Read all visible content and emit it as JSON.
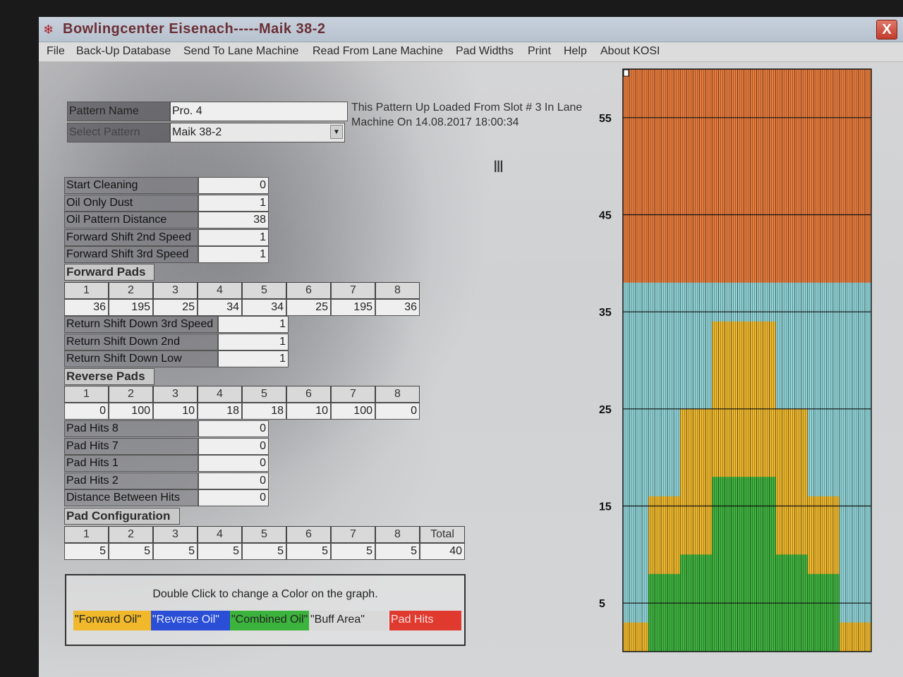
{
  "window": {
    "title": "Bowlingcenter Eisenach-----Maik 38-2",
    "close_label": "X"
  },
  "menu": [
    "File",
    "Back-Up Database",
    "Send To Lane Machine",
    "Read From Lane Machine",
    "Pad Widths",
    "Print",
    "Help",
    "About KOSI"
  ],
  "pattern": {
    "name_label": "Pattern Name",
    "name_value": "Pro. 4",
    "select_label": "Select Pattern",
    "select_value": "Maik 38-2",
    "info": "This Pattern Up Loaded From Slot # 3 In Lane Machine On 14.08.2017 18:00:34"
  },
  "settings": [
    {
      "label": "Start Cleaning",
      "value": "0"
    },
    {
      "label": "Oil Only Dust",
      "value": "1"
    },
    {
      "label": "Oil Pattern Distance",
      "value": "38"
    },
    {
      "label": "Forward Shift 2nd Speed",
      "value": "1"
    },
    {
      "label": "Forward Shift 3rd Speed",
      "value": "1"
    }
  ],
  "forward_pads": {
    "title": "Forward Pads",
    "headers": [
      "1",
      "2",
      "3",
      "4",
      "5",
      "6",
      "7",
      "8"
    ],
    "values": [
      "36",
      "195",
      "25",
      "34",
      "34",
      "25",
      "195",
      "36"
    ]
  },
  "return_shift": [
    {
      "label": "Return Shift Down 3rd Speed",
      "value": "1"
    },
    {
      "label": "Return Shift Down 2nd",
      "value": "1"
    },
    {
      "label": "Return Shift Down Low",
      "value": "1"
    }
  ],
  "reverse_pads": {
    "title": "Reverse Pads",
    "headers": [
      "1",
      "2",
      "3",
      "4",
      "5",
      "6",
      "7",
      "8"
    ],
    "values": [
      "0",
      "100",
      "10",
      "18",
      "18",
      "10",
      "100",
      "0"
    ]
  },
  "pad_hits": [
    {
      "label": "Pad Hits 8",
      "value": "0"
    },
    {
      "label": "Pad Hits 7",
      "value": "0"
    },
    {
      "label": "Pad Hits 1",
      "value": "0"
    },
    {
      "label": "Pad Hits 2",
      "value": "0"
    },
    {
      "label": "Distance Between Hits",
      "value": "0"
    }
  ],
  "pad_config": {
    "title": "Pad Configuration",
    "headers": [
      "1",
      "2",
      "3",
      "4",
      "5",
      "6",
      "7",
      "8",
      "Total"
    ],
    "values": [
      "5",
      "5",
      "5",
      "5",
      "5",
      "5",
      "5",
      "5",
      "40"
    ]
  },
  "legend": {
    "hint": "Double Click  to change a Color on the graph.",
    "items": [
      {
        "label": "\"Forward Oil\"",
        "color": "#f0b82a"
      },
      {
        "label": "\"Reverse Oil\"",
        "color": "#2a4fd6"
      },
      {
        "label": "\"Combined Oil\"",
        "color": "#3cb33c"
      },
      {
        "label": "\"Buff Area\"",
        "color": "#d9d9d9"
      },
      {
        "label": "Pad Hits",
        "color": "#e03a2f"
      }
    ]
  },
  "colors": {
    "forward": "#f0b82a",
    "combined": "#3cb33c",
    "buff": "#d9d9d9",
    "upper_lane": "#e97a3a",
    "pattern_end": "#8fd4d8"
  },
  "chart_data": {
    "type": "area",
    "title": "",
    "ylabel": "",
    "yticks": [
      "55",
      "45",
      "35",
      "25",
      "15",
      "5"
    ],
    "ylim": [
      0,
      60
    ],
    "boards": 39,
    "pattern_length": 38,
    "forward_oil_profile": [
      {
        "from_board": 1,
        "to_board": 4,
        "length": 3
      },
      {
        "from_board": 5,
        "to_board": 9,
        "length": 16
      },
      {
        "from_board": 10,
        "to_board": 14,
        "length": 25
      },
      {
        "from_board": 15,
        "to_board": 24,
        "length": 34
      },
      {
        "from_board": 25,
        "to_board": 29,
        "length": 25
      },
      {
        "from_board": 30,
        "to_board": 34,
        "length": 16
      },
      {
        "from_board": 35,
        "to_board": 39,
        "length": 3
      }
    ],
    "combined_oil_profile": [
      {
        "from_board": 5,
        "to_board": 9,
        "length": 8
      },
      {
        "from_board": 10,
        "to_board": 14,
        "length": 10
      },
      {
        "from_board": 15,
        "to_board": 24,
        "length": 18
      },
      {
        "from_board": 25,
        "to_board": 29,
        "length": 10
      },
      {
        "from_board": 30,
        "to_board": 34,
        "length": 8
      }
    ]
  }
}
